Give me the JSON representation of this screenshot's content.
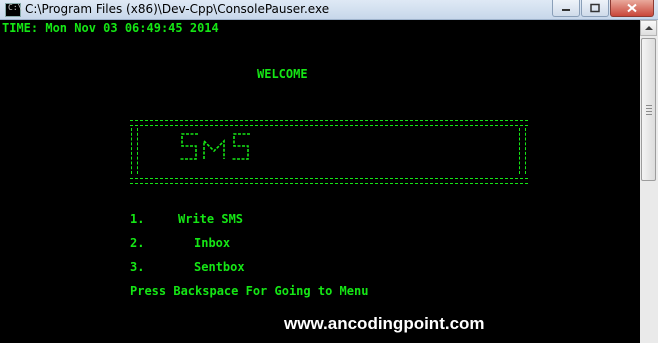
{
  "window": {
    "title": "C:\\Program Files (x86)\\Dev-Cpp\\ConsolePauser.exe",
    "icon": "console-app-icon"
  },
  "console": {
    "timestamp": "TIME: Mon Nov 03 06:49:45 2014",
    "welcome": "WELCOME",
    "logo_text": "SMS",
    "menu": [
      {
        "number": "1.",
        "label": "Write SMS"
      },
      {
        "number": "2.",
        "label": "Inbox"
      },
      {
        "number": "3.",
        "label": "Sentbox"
      }
    ],
    "hint": "Press Backspace For Going to Menu",
    "text_color": "#15e615",
    "background": "#000000"
  },
  "watermark": "www.ancodingpoint.com",
  "scrollbar": {
    "icons": [
      "scroll-up-arrow-icon"
    ]
  }
}
